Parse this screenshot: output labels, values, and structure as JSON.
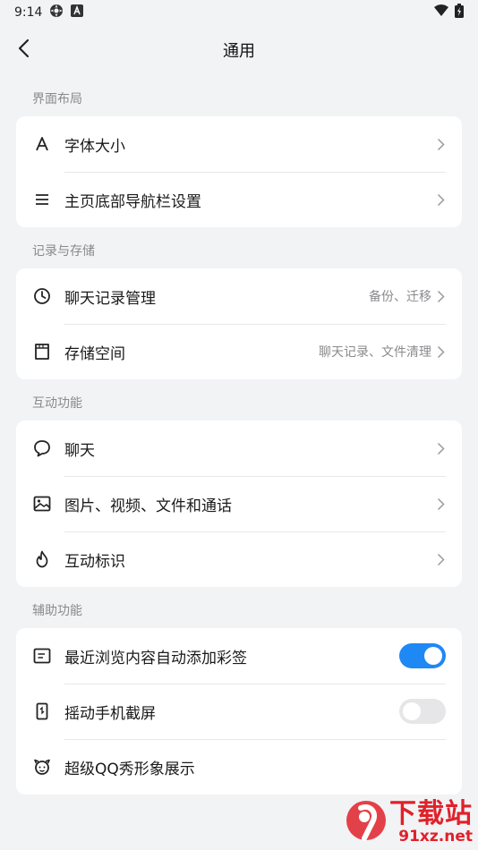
{
  "status_bar": {
    "time": "9:14",
    "icons": [
      "settings-gear-icon",
      "a-badge-icon"
    ],
    "right_icons": [
      "wifi-icon",
      "battery-icon"
    ]
  },
  "header": {
    "title": "通用",
    "back_icon": "chevron-left-icon"
  },
  "sections": [
    {
      "title": "界面布局",
      "items": [
        {
          "label": "字体大小",
          "icon": "font-a-icon",
          "value": "",
          "control": "chevron"
        },
        {
          "label": "主页底部导航栏设置",
          "icon": "menu-lines-icon",
          "value": "",
          "control": "chevron"
        }
      ]
    },
    {
      "title": "记录与存储",
      "items": [
        {
          "label": "聊天记录管理",
          "icon": "clock-icon",
          "value": "备份、迁移",
          "control": "chevron"
        },
        {
          "label": "存储空间",
          "icon": "sd-card-icon",
          "value": "聊天记录、文件清理",
          "control": "chevron"
        }
      ]
    },
    {
      "title": "互动功能",
      "items": [
        {
          "label": "聊天",
          "icon": "chat-bubble-icon",
          "value": "",
          "control": "chevron"
        },
        {
          "label": "图片、视频、文件和通话",
          "icon": "image-icon",
          "value": "",
          "control": "chevron"
        },
        {
          "label": "互动标识",
          "icon": "flame-icon",
          "value": "",
          "control": "chevron"
        }
      ]
    },
    {
      "title": "辅助功能",
      "items": [
        {
          "label": "最近浏览内容自动添加彩签",
          "icon": "note-icon",
          "value": "",
          "control": "toggle",
          "on": true
        },
        {
          "label": "摇动手机截屏",
          "icon": "phone-shake-icon",
          "value": "",
          "control": "toggle",
          "on": false
        },
        {
          "label": "超级QQ秀形象展示",
          "icon": "avatar-face-icon",
          "value": "",
          "control": "none"
        }
      ]
    }
  ],
  "watermark": {
    "big": "下载站",
    "small": "91xz.net"
  },
  "colors": {
    "background": "#f2f3f5",
    "card": "#ffffff",
    "accent_toggle_on": "#1e88f5",
    "toggle_off": "#e6e6e8",
    "secondary_text": "#8a8a8e",
    "watermark": "#e0212a"
  }
}
